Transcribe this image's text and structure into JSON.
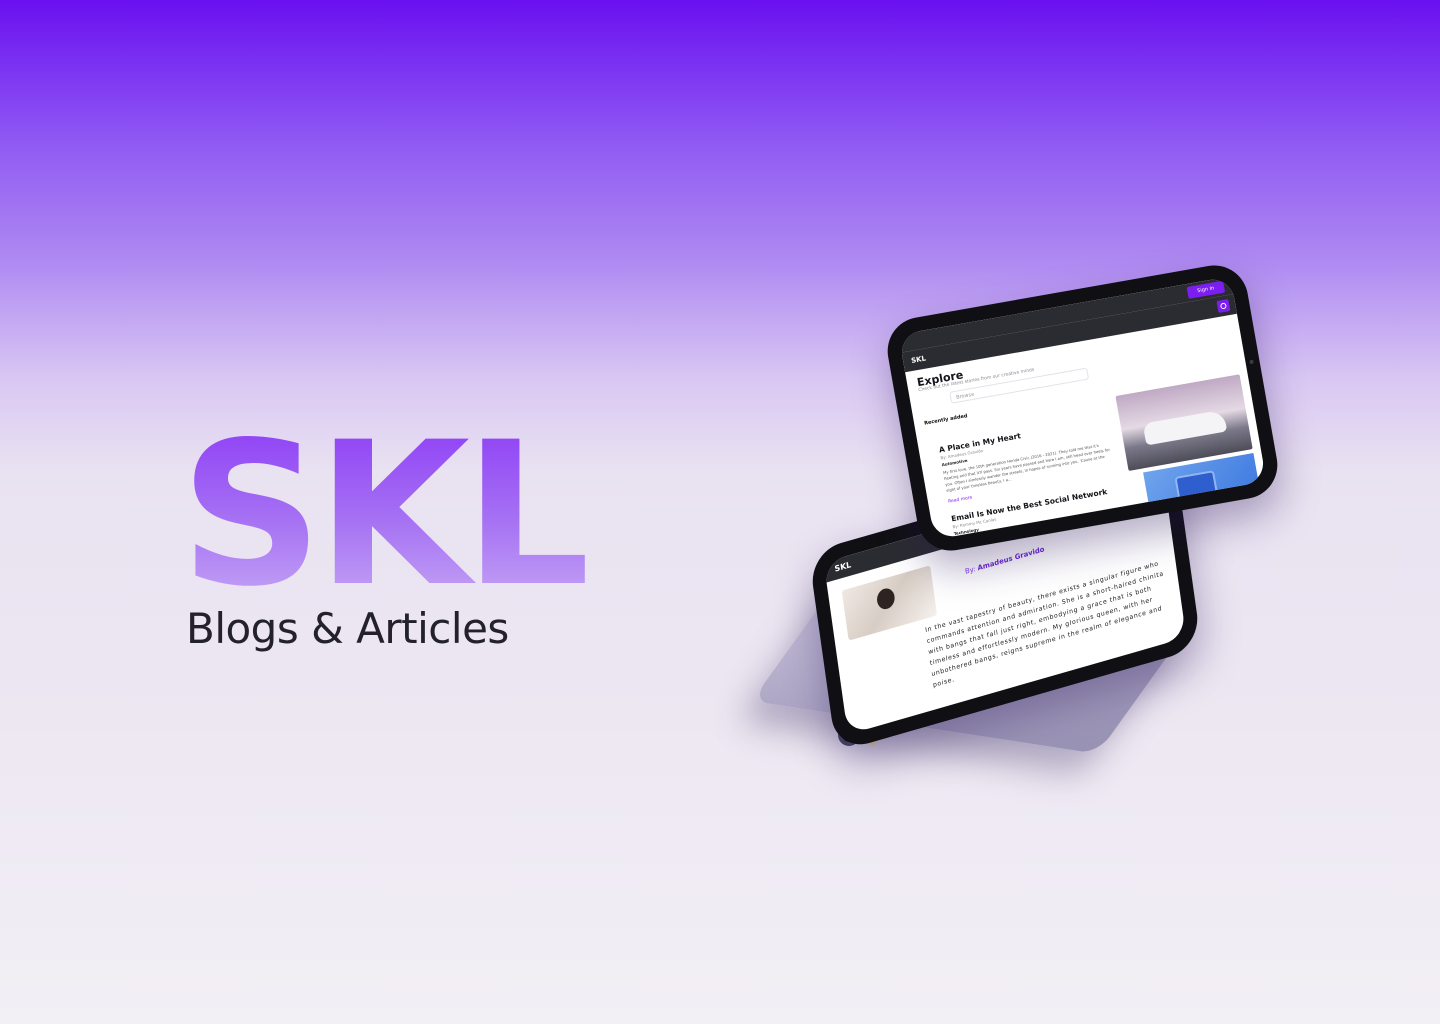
{
  "hero": {
    "brand": "SKL",
    "tagline": "Blogs & Articles"
  },
  "back_screen": {
    "logo": "SKL",
    "author_prefix": "By:",
    "author_name": "Amadeus Gravido",
    "body": "In the vast tapestry of beauty, there exists a singular figure who commands attention and admiration. She is a short-haired chinita with bangs that fall just right, embodying a grace that is both timeless and effortlessly modern. My glorious queen, with her unbothered bangs, reigns supreme in the realm of elegance and poise."
  },
  "front_screen": {
    "sign_in": "Sign In",
    "logo": "SKL",
    "heading": "Explore",
    "subheading": "Check out the latest stories from our creative minds",
    "search_placeholder": "Browse",
    "section_title": "Recently added",
    "posts": [
      {
        "title": "A Place in My Heart",
        "author": "By: Amadeus Gravido",
        "category": "Automotive",
        "excerpt": "My first love, the 10th generation Honda Civic (2016 - 2021). They told me that it's fleeting and that it'll pass. Six years have passed and here I am, still head over heels for you. Often I aimlessly wander the streets, in hopes of running into you. 'Cause at the sight of your timeless beauty, I a...",
        "read_more": "Read more"
      },
      {
        "title": "Email Is Now the Best Social Network",
        "author": "By: Rommy Mc Canlas",
        "category": "Technology"
      }
    ]
  },
  "colors": {
    "accent": "#7c1ef0",
    "text_dark": "#23212a"
  },
  "icons": [
    "search-icon",
    "camera-icon"
  ]
}
